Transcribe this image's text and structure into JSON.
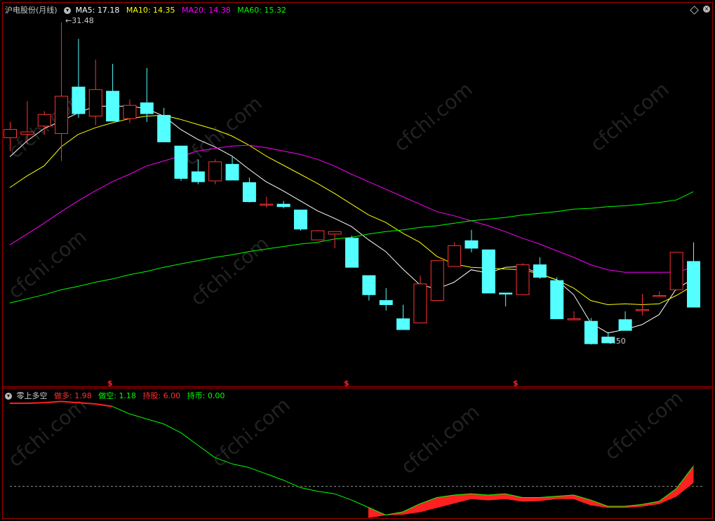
{
  "colors": {
    "bg": "#000000",
    "up": "#ff3232",
    "down": "#54ffff",
    "ma5": "#ffffff",
    "ma10": "#ffff00",
    "ma20": "#ff00ff",
    "ma60": "#00ff00",
    "frame": "#aa0000",
    "buy": "#ff2020",
    "sell": "#00ff00"
  },
  "main": {
    "title": "沪电股份(月线)",
    "ma5_label": "MA5:",
    "ma5": "17.18",
    "ma10_label": "MA10:",
    "ma10": "14.35",
    "ma20_label": "MA20:",
    "ma20": "14.38",
    "ma60_label": "MA60:",
    "ma60": "15.32",
    "high_mark": "31.48",
    "low_mark": "9.50",
    "signal_glyph": "$"
  },
  "sub": {
    "title": "零上多空",
    "zuoduo_label": "做多:",
    "zuoduo": "1.98",
    "zuokong_label": "做空:",
    "zuokong": "1.18",
    "chigu_label": "持股:",
    "chigu": "6.00",
    "chibi_label": "持币:",
    "chibi": "0.00"
  },
  "watermark": "cfchi.com",
  "icons": [
    "dropdown-circle-icon",
    "diamond-icon",
    "arrow-left-icon"
  ],
  "chart_data": {
    "type": "candlestick",
    "title": "沪电股份(月线)",
    "ylim": [
      8.5,
      32.5
    ],
    "candles": [
      {
        "o": 17.6,
        "h": 19.5,
        "l": 16.0,
        "c": 18.6
      },
      {
        "o": 18.0,
        "h": 22.0,
        "l": 16.8,
        "c": 18.3
      },
      {
        "o": 19.0,
        "h": 20.8,
        "l": 18.0,
        "c": 20.4
      },
      {
        "o": 18.1,
        "h": 31.48,
        "l": 14.8,
        "c": 22.6
      },
      {
        "o": 23.7,
        "h": 29.5,
        "l": 20.0,
        "c": 20.5
      },
      {
        "o": 20.2,
        "h": 27.0,
        "l": 19.1,
        "c": 23.4
      },
      {
        "o": 23.2,
        "h": 26.5,
        "l": 19.6,
        "c": 19.6
      },
      {
        "o": 19.9,
        "h": 22.2,
        "l": 19.4,
        "c": 21.5
      },
      {
        "o": 21.8,
        "h": 26.0,
        "l": 19.5,
        "c": 20.5
      },
      {
        "o": 20.3,
        "h": 21.2,
        "l": 17.1,
        "c": 17.1
      },
      {
        "o": 16.6,
        "h": 16.6,
        "l": 12.4,
        "c": 12.7
      },
      {
        "o": 13.5,
        "h": 15.0,
        "l": 12.0,
        "c": 12.3
      },
      {
        "o": 12.4,
        "h": 15.0,
        "l": 12.0,
        "c": 14.7
      },
      {
        "o": 14.4,
        "h": 15.3,
        "l": 12.5,
        "c": 12.5
      },
      {
        "o": 12.2,
        "h": 12.8,
        "l": 9.8,
        "c": 9.9
      },
      {
        "o": 9.6,
        "h": 10.5,
        "l": 9.2,
        "c": 9.6
      },
      {
        "o": 9.6,
        "h": 10.0,
        "l": 9.1,
        "c": 9.3
      },
      {
        "o": 8.9,
        "h": 8.9,
        "l": 6.4,
        "c": 6.6
      },
      {
        "o": 5.3,
        "h": 6.5,
        "l": 5.3,
        "c": 6.4
      },
      {
        "o": 6.0,
        "h": 6.3,
        "l": 4.3,
        "c": 6.3
      },
      {
        "o": 5.5,
        "h": 5.8,
        "l": 2.0,
        "c": 2.0
      },
      {
        "o": 1.0,
        "h": 1.0,
        "l": -2.0,
        "c": -1.3
      },
      {
        "o": -2.0,
        "h": -0.5,
        "l": -3.2,
        "c": -2.5
      },
      {
        "o": -4.2,
        "h": -2.5,
        "l": -5.5,
        "c": -5.5
      },
      {
        "o": -4.7,
        "h": 1.0,
        "l": -4.7,
        "c": 0.0
      },
      {
        "o": -2.0,
        "h": 2.8,
        "l": -2.0,
        "c": 2.8
      },
      {
        "o": 2.1,
        "h": 5.0,
        "l": 2.1,
        "c": 4.6
      },
      {
        "o": 5.2,
        "h": 6.5,
        "l": 3.8,
        "c": 4.3
      },
      {
        "o": 4.1,
        "h": 4.1,
        "l": -0.8,
        "c": -1.1
      },
      {
        "o": -1.1,
        "h": -1.1,
        "l": -2.7,
        "c": -1.2
      },
      {
        "o": -1.3,
        "h": 2.5,
        "l": -1.3,
        "c": 2.3
      },
      {
        "o": 2.3,
        "h": 3.2,
        "l": 0.6,
        "c": 0.8
      },
      {
        "o": 0.4,
        "h": 0.8,
        "l": -4.1,
        "c": -4.2
      },
      {
        "o": -4.2,
        "h": -3.3,
        "l": -4.2,
        "c": -4.2
      },
      {
        "o": -4.5,
        "h": -4.1,
        "l": -7.3,
        "c": -7.2
      },
      {
        "o": -6.4,
        "h": -5.8,
        "l": -7.1,
        "c": -7.1
      },
      {
        "o": -4.3,
        "h": -3.3,
        "l": -5.6,
        "c": -5.6
      },
      {
        "o": -3.2,
        "h": -1.2,
        "l": -3.8,
        "c": -3.1
      },
      {
        "o": -1.4,
        "h": -0.9,
        "l": -1.4,
        "c": -1.4
      },
      {
        "o": -0.7,
        "h": 3.8,
        "l": -0.8,
        "c": 3.8
      },
      {
        "o": 2.7,
        "h": 5.0,
        "l": -2.8,
        "c": -2.8
      }
    ],
    "ma5": [
      15.3,
      17.2,
      18.7,
      19.6,
      20.6,
      21.4,
      21.4,
      21.4,
      21.1,
      20.2,
      18.6,
      17.4,
      16.5,
      15.4,
      13.8,
      12.3,
      11.2,
      10.0,
      8.8,
      7.9,
      6.9,
      5.3,
      3.9,
      1.8,
      -0.1,
      -0.6,
      0.2,
      1.7,
      1.3,
      2.0,
      2.1,
      1.2,
      0.5,
      -1.3,
      -4.7,
      -5.9,
      -5.5,
      -4.9,
      -3.7,
      -0.6,
      0.6
    ],
    "ma10": [
      11.6,
      13.0,
      14.2,
      16.5,
      18.0,
      18.8,
      19.4,
      19.9,
      20.2,
      20.3,
      19.8,
      19.2,
      18.6,
      17.8,
      16.7,
      15.4,
      14.3,
      13.2,
      12.1,
      10.9,
      9.6,
      8.3,
      7.4,
      6.1,
      5.0,
      3.3,
      2.4,
      2.0,
      1.9,
      1.8,
      1.7,
      1.2,
      0.5,
      -0.5,
      -2.0,
      -2.5,
      -2.4,
      -2.5,
      -2.4,
      -1.4,
      -0.2
    ],
    "ma20": [
      4.7,
      6.0,
      7.3,
      8.7,
      10.0,
      11.2,
      12.3,
      13.2,
      14.2,
      14.8,
      15.4,
      16.0,
      16.3,
      16.6,
      16.7,
      16.4,
      16.0,
      15.6,
      15.0,
      14.2,
      13.2,
      12.3,
      11.4,
      10.5,
      9.6,
      8.7,
      8.2,
      7.6,
      7.0,
      6.3,
      5.5,
      4.8,
      4.0,
      3.2,
      2.3,
      1.7,
      1.4,
      1.4,
      1.4,
      1.4,
      2.0
    ],
    "ma60": [
      -2.3,
      -1.8,
      -1.3,
      -0.7,
      -0.3,
      0.2,
      0.6,
      1.1,
      1.5,
      2.0,
      2.4,
      2.8,
      3.2,
      3.5,
      3.9,
      4.2,
      4.5,
      4.8,
      5.0,
      5.4,
      5.6,
      6.0,
      6.3,
      6.5,
      6.8,
      7.0,
      7.3,
      7.6,
      7.8,
      8.0,
      8.3,
      8.5,
      8.7,
      9.0,
      9.1,
      9.3,
      9.4,
      9.6,
      9.8,
      10.1,
      11.1
    ],
    "high_label": 31.48,
    "low_label": 9.5,
    "signals_at": [
      6,
      20,
      30
    ],
    "sub": {
      "title": "零上多空",
      "ylim": [
        0,
        10
      ],
      "zero_line": 2.5,
      "line": [
        9.15,
        9.15,
        9.2,
        9.3,
        9.2,
        9.1,
        8.9,
        8.3,
        7.9,
        7.5,
        6.8,
        5.8,
        4.8,
        4.3,
        4.0,
        3.5,
        3.0,
        2.4,
        2.1,
        1.9,
        1.4,
        0.8,
        0.2,
        0.45,
        1.1,
        1.6,
        1.8,
        1.9,
        1.8,
        1.9,
        1.6,
        1.6,
        1.7,
        1.8,
        1.4,
        0.9,
        0.9,
        1.05,
        1.3,
        2.3,
        4.1
      ],
      "buy_segments": [
        [
          21,
          41
        ]
      ],
      "segment_low": [
        0,
        0,
        0,
        0,
        0,
        0,
        0,
        0,
        0,
        0,
        0,
        0,
        0,
        0,
        0,
        0,
        0,
        0,
        0,
        0,
        0,
        0,
        0.2,
        0.25,
        0.45,
        0.8,
        1.15,
        1.5,
        1.4,
        1.5,
        1.3,
        1.35,
        1.5,
        1.5,
        1.0,
        0.8,
        0.8,
        0.9,
        1.1,
        1.7,
        2.8
      ]
    }
  }
}
